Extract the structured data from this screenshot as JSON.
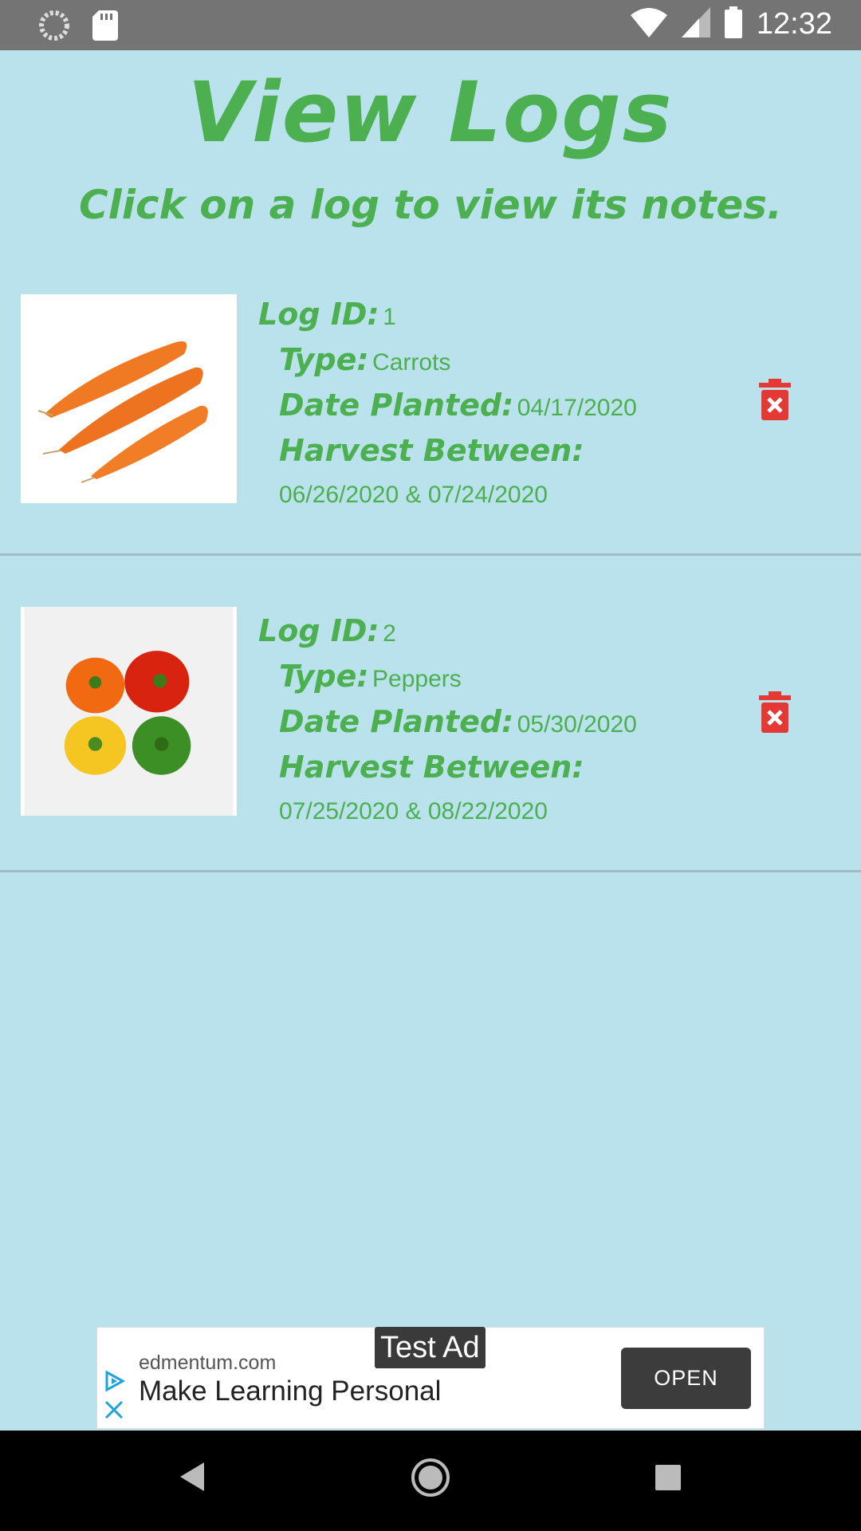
{
  "status_bar": {
    "time": "12:32"
  },
  "header": {
    "title": "View Logs",
    "subtitle": "Click on a log to view its notes."
  },
  "labels": {
    "log_id": "Log ID:",
    "type": "Type:",
    "date_planted": "Date Planted:",
    "harvest_between": "Harvest Between:"
  },
  "logs": [
    {
      "id": "1",
      "type": "Carrots",
      "date_planted": "04/17/2020",
      "harvest_range": "06/26/2020 & 07/24/2020",
      "image": "carrots-photo"
    },
    {
      "id": "2",
      "type": "Peppers",
      "date_planted": "05/30/2020",
      "harvest_range": "07/25/2020 & 08/22/2020",
      "image": "peppers-photo"
    }
  ],
  "ad": {
    "badge": "Test Ad",
    "domain": "edmentum.com",
    "headline": "Make Learning Personal",
    "button": "OPEN"
  },
  "colors": {
    "background": "#b9e2ec",
    "accent_green": "#4caf50",
    "delete_red": "#e53935",
    "status_bar": "#747474"
  }
}
